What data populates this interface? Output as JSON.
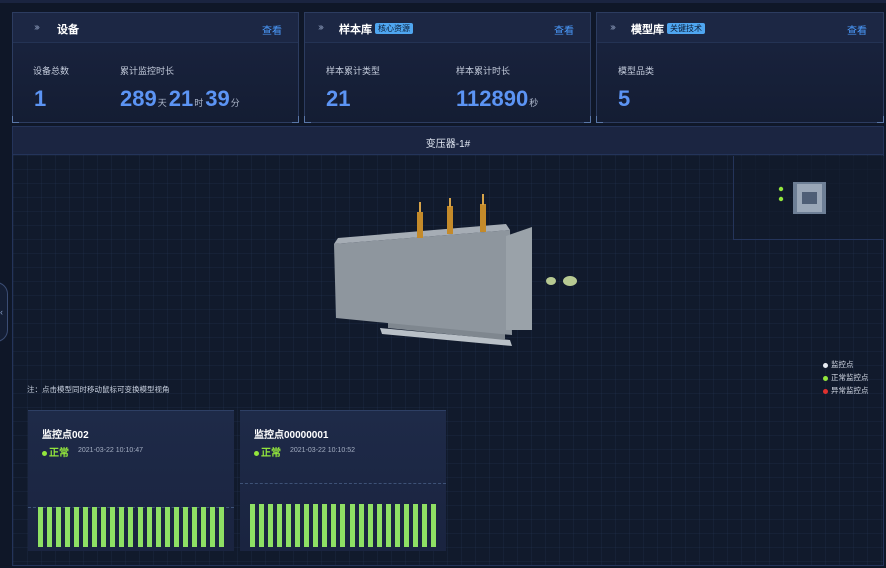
{
  "cards": {
    "device": {
      "title": "设备",
      "view": "查看",
      "total_label": "设备总数",
      "total_value": "1",
      "duration_label": "累计监控时长",
      "duration": {
        "days": "289",
        "days_unit": "天",
        "hours": "21",
        "hours_unit": "时",
        "minutes": "39",
        "minutes_unit": "分"
      }
    },
    "samples": {
      "title": "样本库",
      "tag": "核心资源",
      "view": "查看",
      "types_label": "样本累计类型",
      "types_value": "21",
      "duration_label": "样本累计时长",
      "duration_value": "112890",
      "duration_unit": "秒"
    },
    "models": {
      "title": "模型库",
      "tag": "关键技术",
      "view": "查看",
      "category_label": "模型品类",
      "category_value": "5"
    }
  },
  "main": {
    "title": "变压器-1#",
    "note": "注：点击模型同时移动鼠标可变换模型视角",
    "legend": [
      {
        "label": "监控点",
        "color": "#e8ecf3"
      },
      {
        "label": "正常监控点",
        "color": "#93e63c"
      },
      {
        "label": "异常监控点",
        "color": "#e0312f"
      }
    ]
  },
  "monitors": [
    {
      "name": "监控点002",
      "status": "正常",
      "time": "2021-03-22 10:10:47",
      "bars": [
        0.92,
        0.92,
        0.92,
        0.92,
        0.92,
        0.92,
        0.92,
        0.92,
        0.92,
        0.92,
        0.92,
        0.92,
        0.92,
        0.92,
        0.92,
        0.92,
        0.92,
        0.92,
        0.92,
        0.92,
        0.92
      ]
    },
    {
      "name": "监控点00000001",
      "status": "正常",
      "time": "2021-03-22 10:10:52",
      "bars": [
        0.98,
        0.98,
        0.98,
        0.98,
        0.98,
        0.98,
        0.98,
        0.98,
        0.98,
        0.98,
        0.98,
        0.98,
        0.98,
        0.98,
        0.98,
        0.98,
        0.98,
        0.98,
        0.98,
        0.98,
        0.98
      ]
    }
  ],
  "colors": {
    "accent": "#5c94f4",
    "normal": "#93e63c",
    "abnormal": "#e0312f",
    "link": "#4b9cff"
  }
}
